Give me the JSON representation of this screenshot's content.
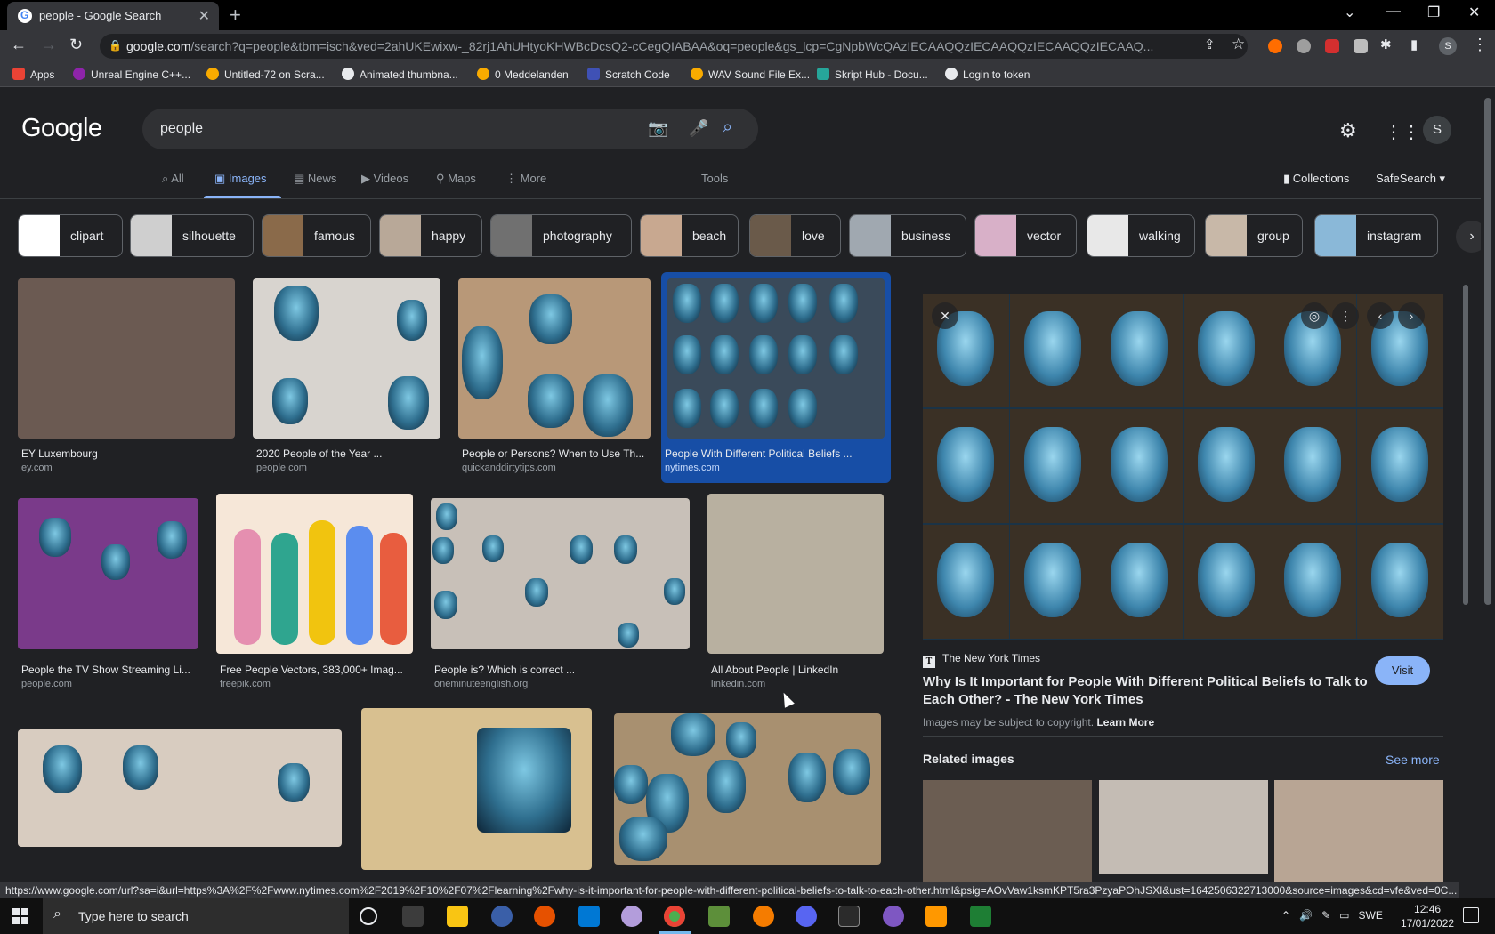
{
  "browser": {
    "tab_title": "people - Google Search",
    "url_host": "google.com",
    "url_path": "/search?q=people&tbm=isch&ved=2ahUKEwixw-_82rj1AhUHtyoKHWBcDcsQ2-cCegQIABAA&oq=people&gs_lcp=CgNpbWcQAzIECAAQQzIECAAQQzIECAAQQzIECAAQ...",
    "avatar_letter": "S"
  },
  "bookmarks": [
    {
      "label": "Apps",
      "color": "#ea4335"
    },
    {
      "label": "Unreal Engine C++...",
      "color": "#8e24aa"
    },
    {
      "label": "Untitled-72 on Scra...",
      "color": "#f9ab00"
    },
    {
      "label": "Animated thumbna...",
      "color": "#e8eaed"
    },
    {
      "label": "0 Meddelanden",
      "color": "#f9ab00"
    },
    {
      "label": "Scratch Code",
      "color": "#3f51b5"
    },
    {
      "label": "WAV Sound File Ex...",
      "color": "#f9ab00"
    },
    {
      "label": "Skript Hub - Docu...",
      "color": "#26a69a"
    },
    {
      "label": "Login to token",
      "color": "#e8eaed"
    }
  ],
  "google": {
    "logo": "Google",
    "query": "people",
    "tabs": [
      "All",
      "Images",
      "News",
      "Videos",
      "Maps",
      "More"
    ],
    "tools": "Tools",
    "collections": "Collections",
    "safesearch": "SafeSearch"
  },
  "chips": [
    {
      "label": "clipart",
      "color": "#ffffff"
    },
    {
      "label": "silhouette",
      "color": "#cfcfcf"
    },
    {
      "label": "famous",
      "color": "#8a6a4a"
    },
    {
      "label": "happy",
      "color": "#b8a898"
    },
    {
      "label": "photography",
      "color": "#707070"
    },
    {
      "label": "beach",
      "color": "#c8a890"
    },
    {
      "label": "love",
      "color": "#6a5a4a"
    },
    {
      "label": "business",
      "color": "#a0a8b0"
    },
    {
      "label": "vector",
      "color": "#d8b0c8"
    },
    {
      "label": "walking",
      "color": "#e8e8e8"
    },
    {
      "label": "group",
      "color": "#c8b8a8"
    },
    {
      "label": "instagram",
      "color": "#8ab8d8"
    }
  ],
  "results": [
    {
      "caption": "EY Luxembourg",
      "source": "ey.com",
      "bg": "#6b5a52"
    },
    {
      "caption": "2020 People of the Year ...",
      "source": "people.com",
      "bg": "#d8d4cf"
    },
    {
      "caption": "People or Persons? When to Use Th...",
      "source": "quickanddirtytips.com",
      "bg": "#b89878"
    },
    {
      "caption": "People With Different Political Beliefs ...",
      "source": "nytimes.com",
      "bg": "#3a4a5a"
    },
    {
      "caption": "People the TV Show Streaming Li...",
      "source": "people.com",
      "bg": "#7a3a8a"
    },
    {
      "caption": "Free People Vectors, 383,000+ Imag...",
      "source": "freepik.com",
      "bg": "#f6e7d8"
    },
    {
      "caption": "People is? Which is correct ...",
      "source": "oneminuteenglish.org",
      "bg": "#c8c0b8"
    },
    {
      "caption": "All About People | LinkedIn",
      "source": "linkedin.com",
      "bg": "#b8b0a0"
    },
    {
      "caption": "",
      "source": "",
      "bg": "#d8ccc0"
    },
    {
      "caption": "",
      "source": "",
      "bg": "#d8c090"
    },
    {
      "caption": "",
      "source": "",
      "bg": "#a89070"
    }
  ],
  "panel": {
    "source": "The New York Times",
    "title": "Why Is It Important for People With Different Political Beliefs to Talk to Each Other? - The New York Times",
    "visit": "Visit",
    "copyright": "Images may be subject to copyright.",
    "learn_more": "Learn More",
    "related": "Related images",
    "see_more": "See more"
  },
  "status_url": "https://www.google.com/url?sa=i&url=https%3A%2F%2Fwww.nytimes.com%2F2019%2F10%2F07%2Flearning%2Fwhy-is-it-important-for-people-with-different-political-beliefs-to-talk-to-each-other.html&psig=AOvVaw1ksmKPT5ra3PzyaPOhJSXI&ust=1642506322713000&source=images&cd=vfe&ved=0C...",
  "taskbar": {
    "search_placeholder": "Type here to search",
    "lang": "SWE",
    "time": "12:46",
    "date": "17/01/2022"
  }
}
